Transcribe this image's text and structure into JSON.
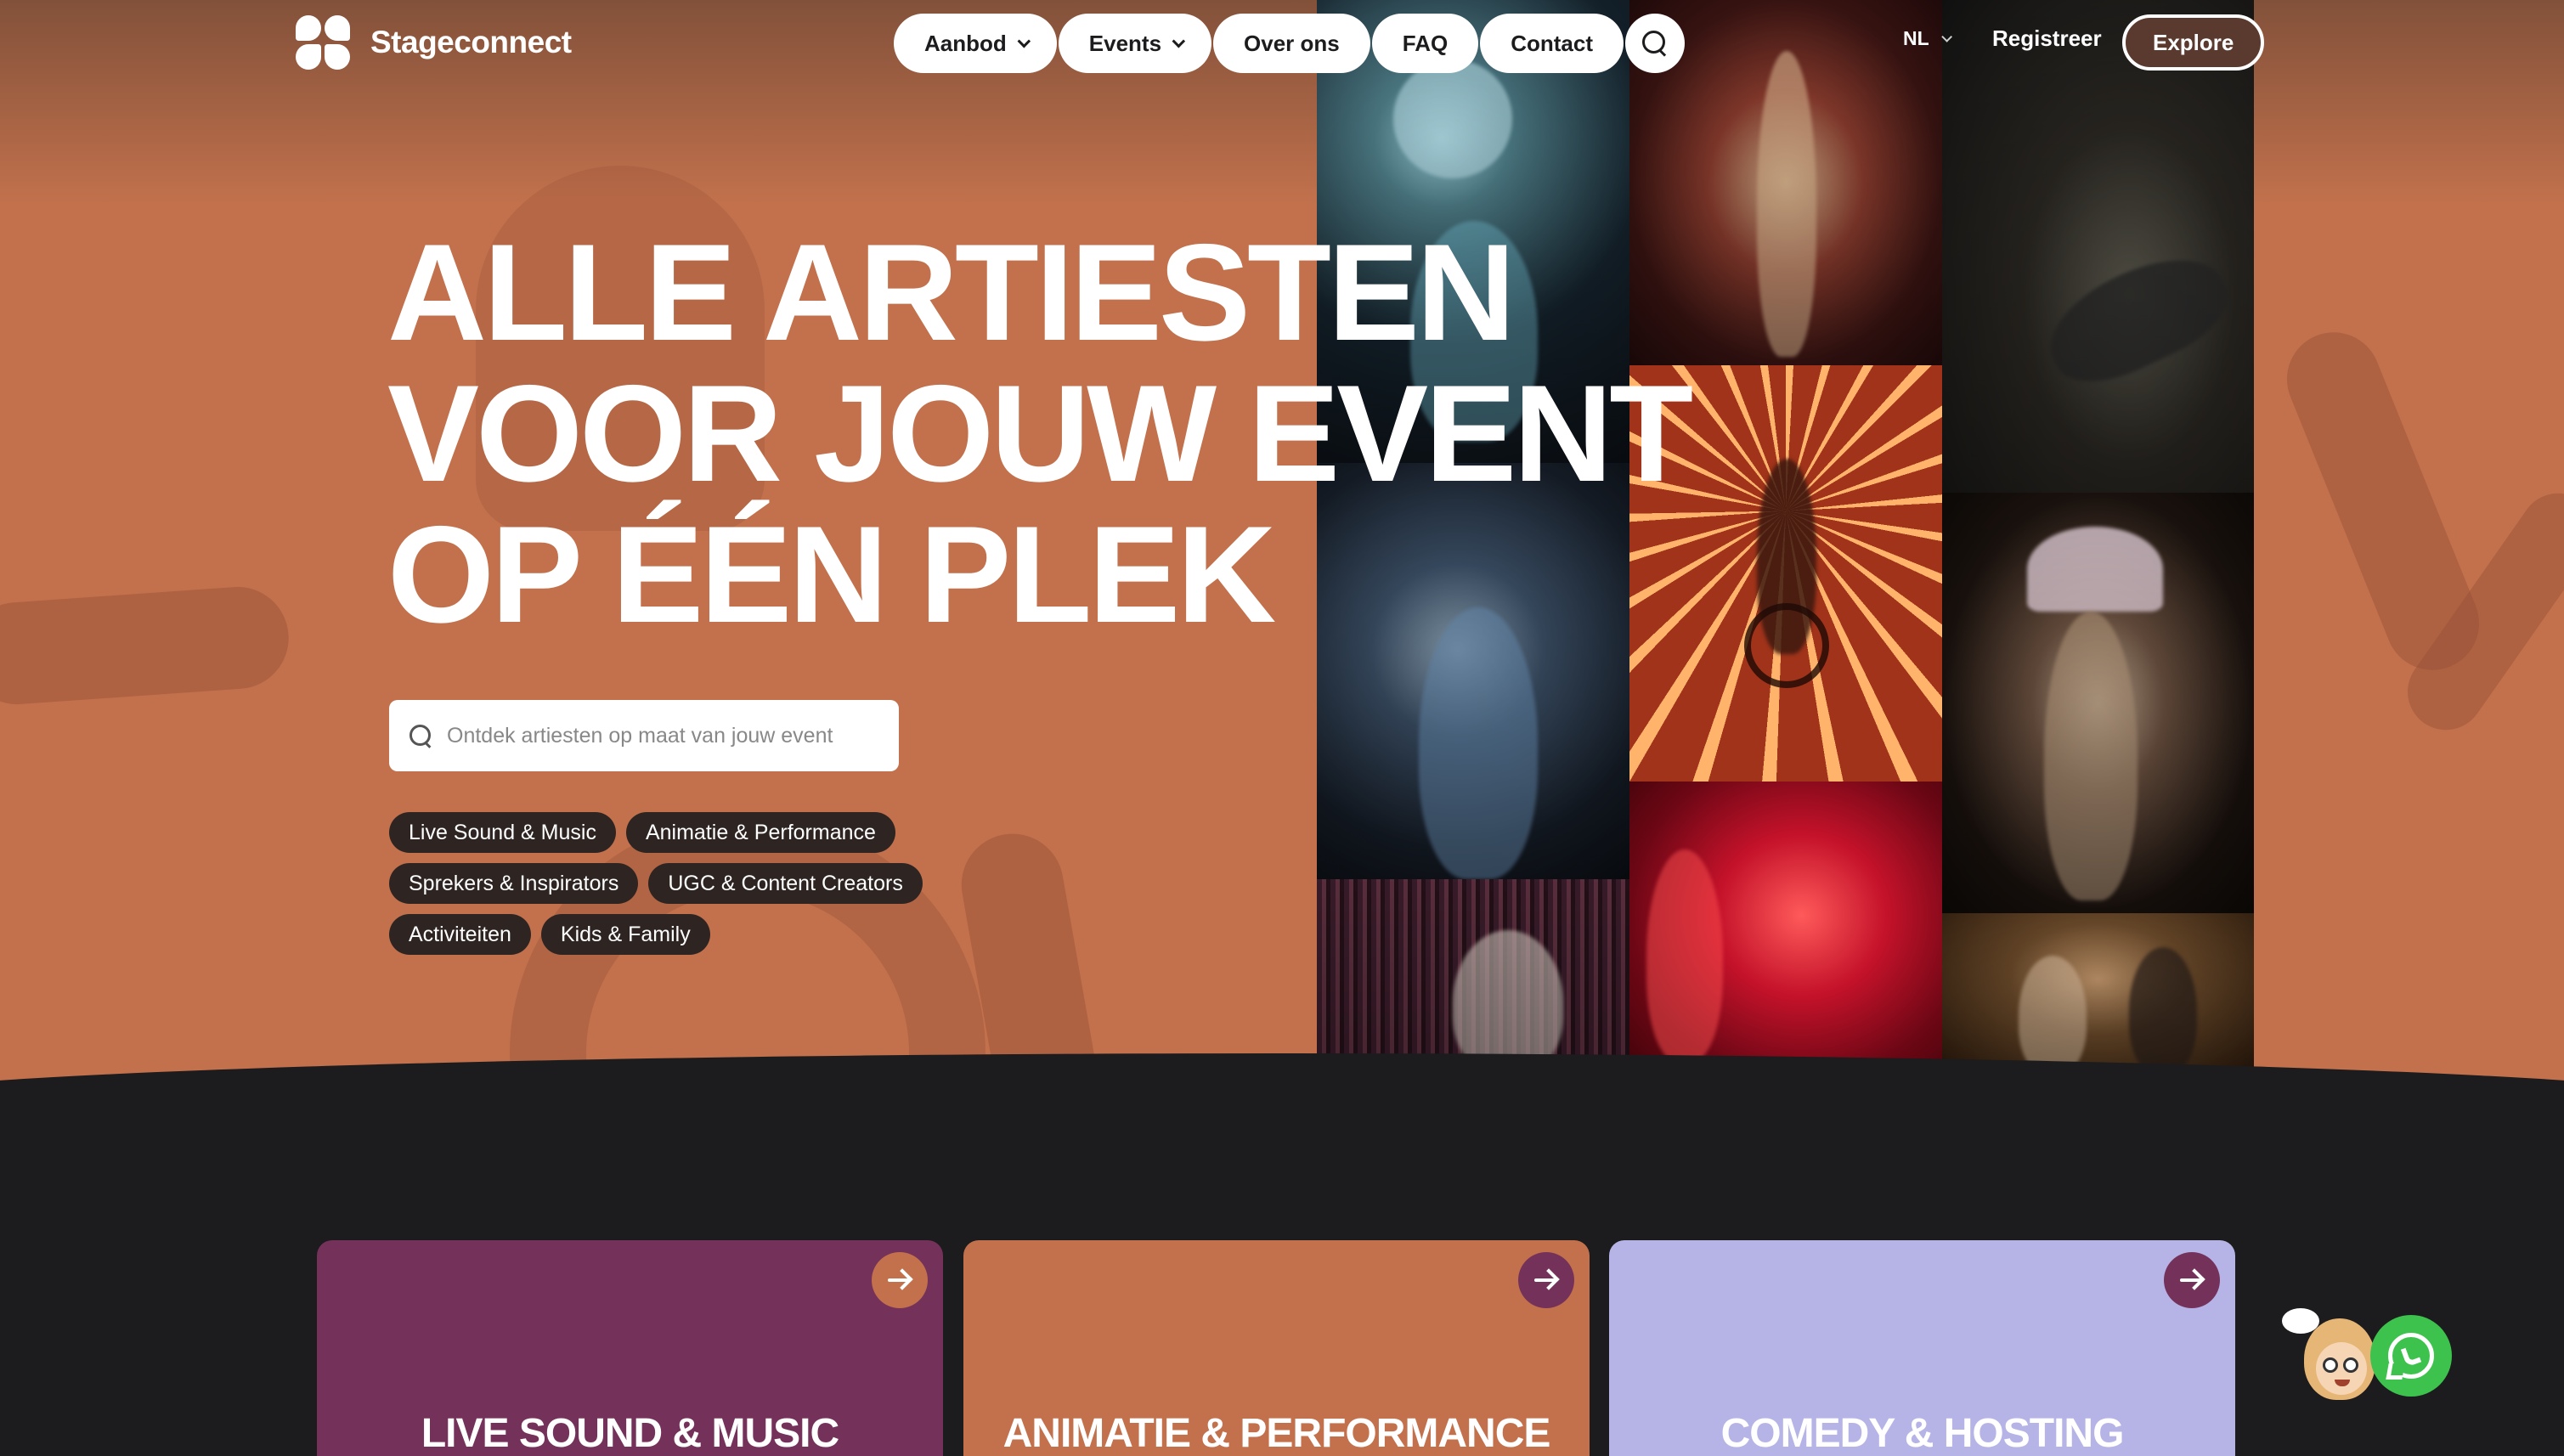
{
  "brand": {
    "name": "Stageconnect"
  },
  "nav": {
    "items": [
      {
        "label": "Aanbod",
        "has_dropdown": true
      },
      {
        "label": "Events",
        "has_dropdown": true
      },
      {
        "label": "Over ons",
        "has_dropdown": false
      },
      {
        "label": "FAQ",
        "has_dropdown": false
      },
      {
        "label": "Contact",
        "has_dropdown": false
      }
    ],
    "search_icon": "search-icon",
    "language": "NL",
    "register_label": "Registreer",
    "explore_label": "Explore"
  },
  "hero": {
    "headline_lines": [
      "ALLE ARTIESTEN",
      "VOOR JOUW EVENT",
      "OP ÉÉN PLEK"
    ],
    "search_placeholder": "Ontdek artiesten op maat van jouw event",
    "tags": [
      "Live Sound & Music",
      "Animatie & Performance",
      "Sprekers & Inspirators",
      "UGC & Content Creators",
      "Activiteiten",
      "Kids & Family"
    ]
  },
  "categories": [
    {
      "title": "LIVE SOUND & MUSIC",
      "color": "#74325a",
      "icon": "arrow-right-icon"
    },
    {
      "title": "ANIMATIE & PERFORMANCE",
      "color": "#c2714c",
      "icon": "arrow-right-icon"
    },
    {
      "title": "COMEDY & HOSTING",
      "color": "#b6b4e6",
      "icon": "arrow-right-icon"
    }
  ],
  "colors": {
    "hero_bg": "#c2714c",
    "page_bg": "#1c1b1d",
    "tag_bg": "#2e2523",
    "whatsapp": "#3dc24e"
  },
  "floating": {
    "chat_mascot_icon": "mascot-avatar-icon",
    "whatsapp_icon": "whatsapp-icon"
  }
}
